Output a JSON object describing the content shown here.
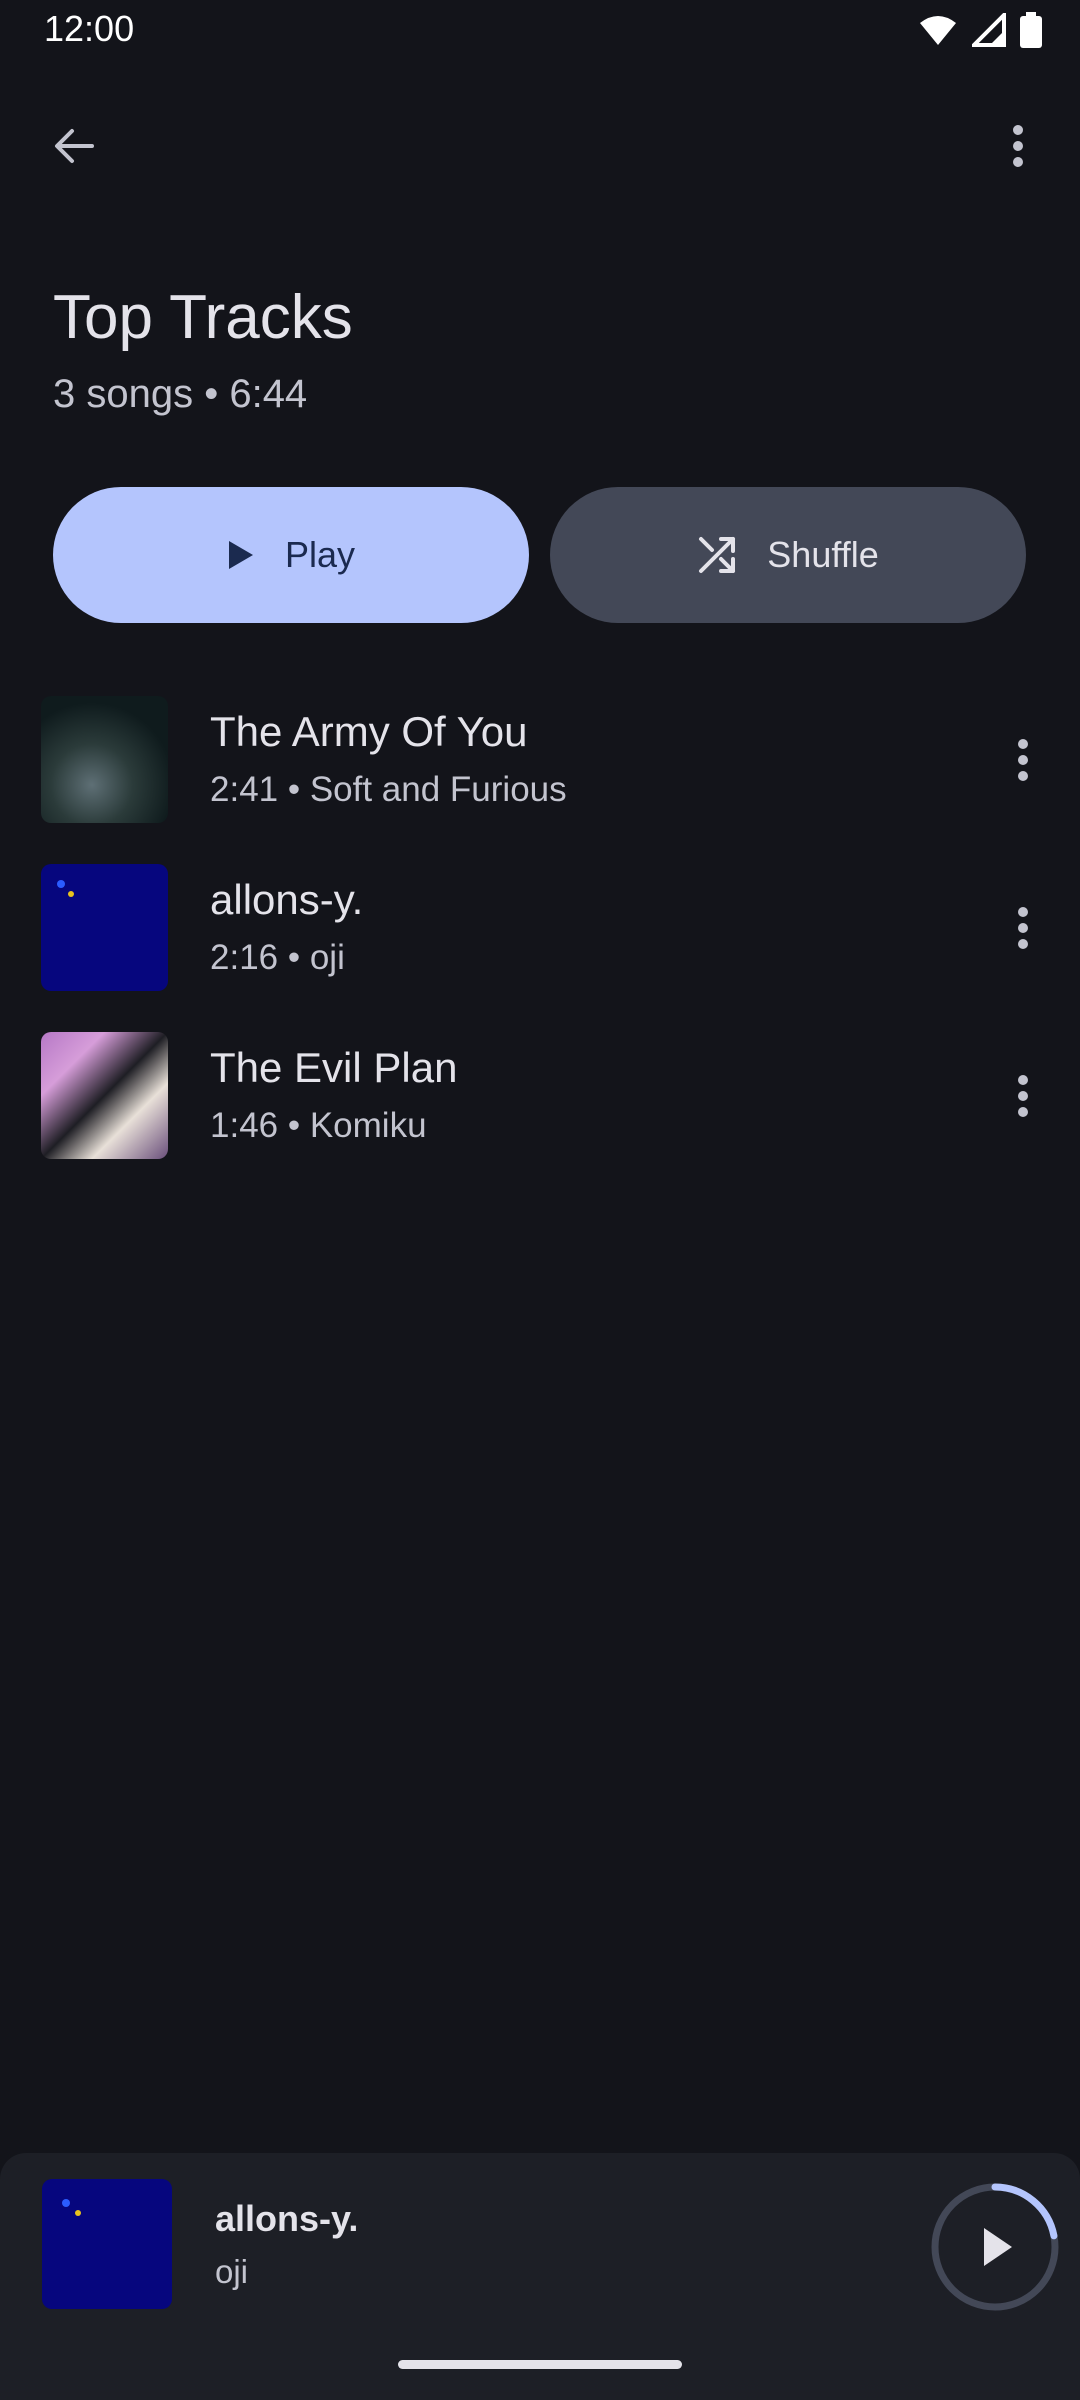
{
  "status_bar": {
    "time": "12:00"
  },
  "header": {
    "title": "Top Tracks",
    "subtitle": "3 songs • 6:44"
  },
  "actions": {
    "play_label": "Play",
    "shuffle_label": "Shuffle"
  },
  "tracks": [
    {
      "title": "The Army Of You",
      "meta": "2:41 • Soft and Furious"
    },
    {
      "title": "allons-y.",
      "meta": "2:16 • oji"
    },
    {
      "title": "The Evil Plan",
      "meta": "1:46 • Komiku"
    }
  ],
  "now_playing": {
    "title": "allons-y.",
    "artist": "oji",
    "progress": 0.22
  },
  "colors": {
    "background": "#13141a",
    "play_button": "#b4c5fd",
    "shuffle_button": "#434857",
    "progress_ring": "#b4c5fd"
  },
  "icons": {
    "back": "arrow-back-icon",
    "overflow": "more-vertical-icon",
    "play": "play-icon",
    "shuffle": "shuffle-icon",
    "wifi": "wifi-icon",
    "signal": "signal-icon",
    "battery": "battery-icon"
  }
}
